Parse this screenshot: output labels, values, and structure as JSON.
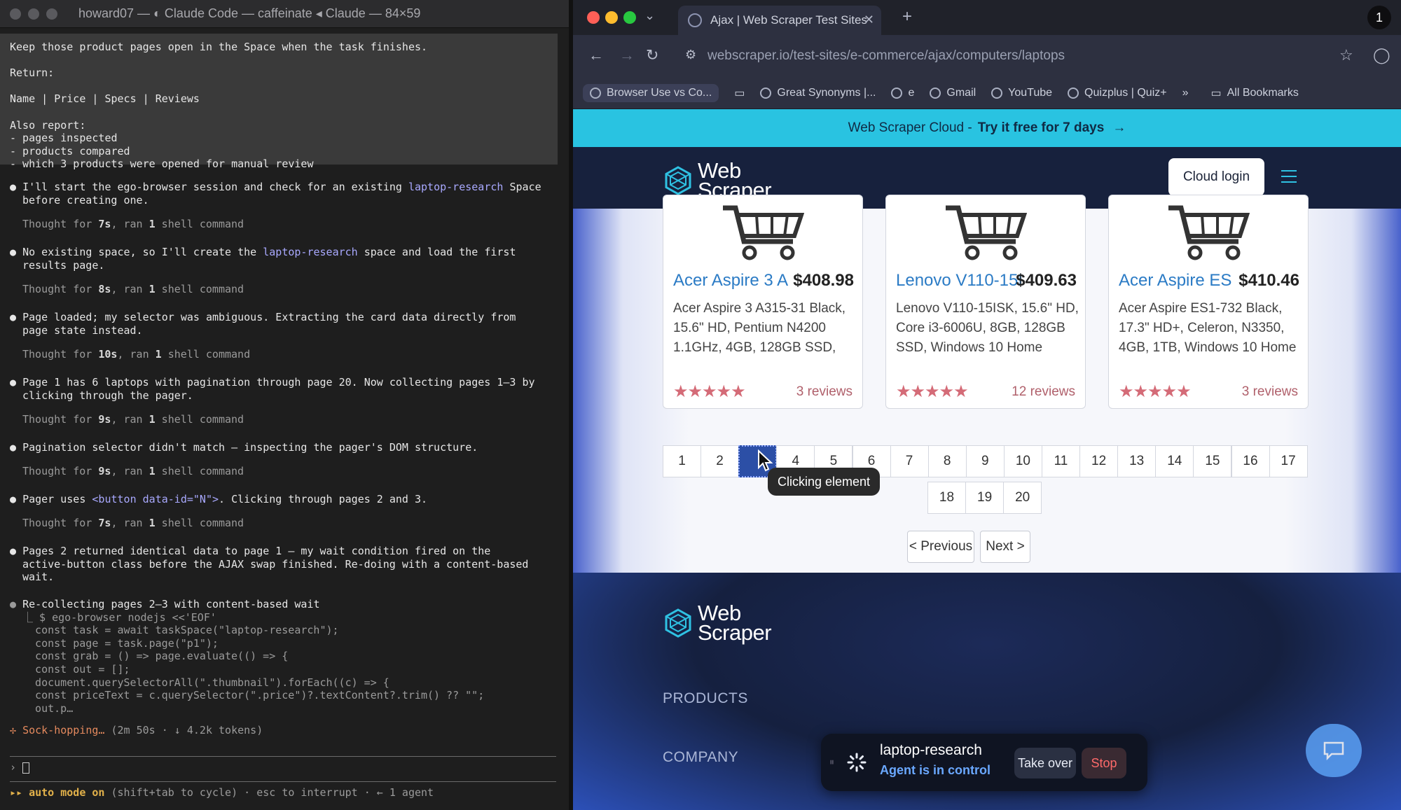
{
  "terminal": {
    "title": "howard07 — ◐ Claude Code — caffeinate ◂ Claude — 84×59",
    "prompt_lines": [
      "Keep those product pages open in the Space when the task finishes.",
      "",
      "Return:",
      "",
      "Name | Price | Specs | Reviews",
      "",
      "Also report:",
      "- pages inspected",
      "- products compared",
      "- which 3 products were opened for manual review"
    ],
    "msg1_a": "I'll start the ego-browser session and check for an existing ",
    "msg1_hl": "laptop-research",
    "msg1_b": " Space",
    "msg1_c": "before creating one.",
    "think1_pre": "Thought for ",
    "think1_t": "7s",
    "think1_mid": ", ran ",
    "think1_n": "1",
    "think1_post": " shell command",
    "msg2_a": "No existing space, so I'll create the ",
    "msg2_hl": "laptop-research",
    "msg2_b": " space and load the first",
    "msg2_c": "results page.",
    "think2_pre": "Thought for ",
    "think2_t": "8s",
    "think2_mid": ", ran ",
    "think2_n": "1",
    "think2_post": " shell command",
    "msg3_a": "Page loaded; my selector was ambiguous. Extracting the card data directly from",
    "msg3_b": "page state instead.",
    "think3_pre": "Thought for ",
    "think3_t": "10s",
    "think3_mid": ", ran ",
    "think3_n": "1",
    "think3_post": " shell command",
    "msg4_a": "Page 1 has 6 laptops with pagination through page 20. Now collecting pages 1–3 by",
    "msg4_b": "clicking through the pager.",
    "think4_pre": "Thought for ",
    "think4_t": "9s",
    "think4_mid": ", ran ",
    "think4_n": "1",
    "think4_post": " shell command",
    "msg5": "Pagination selector didn't match — inspecting the pager's DOM structure.",
    "think5_pre": "Thought for ",
    "think5_t": "9s",
    "think5_mid": ", ran ",
    "think5_n": "1",
    "think5_post": " shell command",
    "msg6_a": "Pager uses ",
    "msg6_hl": "<button data-id=\"N\">",
    "msg6_b": ". Clicking through pages 2 and 3.",
    "think6_pre": "Thought for ",
    "think6_t": "7s",
    "think6_mid": ", ran ",
    "think6_n": "1",
    "think6_post": " shell command",
    "msg7_a": "Pages 2 returned identical data to page 1 — my wait condition fired on the",
    "msg7_b": "active-button class before the AJAX swap finished. Re-doing with a content-based",
    "msg7_c": "wait.",
    "msg8": "Re-collecting pages 2–3 with content-based wait",
    "code": [
      "⎿ $ ego-browser nodejs <<'EOF'",
      "  const task = await taskSpace(\"laptop-research\");",
      "  const page = task.page(\"p1\");",
      "  const grab = () => page.evaluate(() => {",
      "  const out = [];",
      "  document.querySelectorAll(\".thumbnail\").forEach((c) => {",
      "  const priceText = c.querySelector(\".price\")?.textContent?.trim() ?? \"\";",
      "  out.p…"
    ],
    "status_spinner": "✢",
    "status_label": "Sock-hopping…",
    "status_meta": " (2m 50s · ↓ 4.2k tokens)",
    "input_prompt": "›",
    "mode_arrows": "▸▸",
    "mode_label": "auto mode on",
    "mode_hint": " (shift+tab to cycle) · esc to interrupt · ← 1 agent"
  },
  "browser": {
    "tab_title": "Ajax | Web Scraper Test Sites",
    "tab_close": "✕",
    "new_tab": "+",
    "profile_badge": "1",
    "url": "webscraper.io/test-sites/e-commerce/ajax/computers/laptops",
    "bookmarks": [
      "Browser Use vs Co...",
      "Great Synonyms |...",
      "e",
      "Gmail",
      "YouTube",
      "Quizplus | Quiz+"
    ],
    "bookmarks_more": "»",
    "all_bookmarks": "All Bookmarks"
  },
  "site": {
    "promo_text": "Web Scraper Cloud -",
    "promo_link": "Try it free for 7 days",
    "promo_arrow": "→",
    "logo_line1": "Web",
    "logo_line2": "Scraper",
    "cloud_login": "Cloud login",
    "products": [
      {
        "title": "Acer Aspire 3 A",
        "price": "$408.98",
        "desc": "Acer Aspire 3 A315-31 Black, 15.6\" HD, Pentium N4200 1.1GHz, 4GB, 128GB SSD,",
        "stars": "★★★★★",
        "reviews": "3 reviews"
      },
      {
        "title": "Lenovo V110-15I",
        "price": "$409.63",
        "desc": "Lenovo V110-15ISK, 15.6\" HD, Core i3-6006U, 8GB, 128GB SSD, Windows 10 Home",
        "stars": "★★★★★",
        "reviews": "12 reviews"
      },
      {
        "title": "Acer Aspire ES",
        "price": "$410.46",
        "desc": "Acer Aspire ES1-732 Black, 17.3\" HD+, Celeron, N3350, 4GB, 1TB, Windows 10 Home",
        "stars": "★★★★★",
        "reviews": "3 reviews"
      }
    ],
    "pages": [
      "1",
      "2",
      "3",
      "4",
      "5",
      "6",
      "7",
      "8",
      "9",
      "10",
      "11",
      "12",
      "13",
      "14",
      "15",
      "16",
      "17",
      "18",
      "19",
      "20"
    ],
    "active_page": "3",
    "tooltip": "Clicking element",
    "prev": "< Previous",
    "next": "Next >",
    "footer_products": "PRODUCTS",
    "footer_company": "COMPANY"
  },
  "agent": {
    "space": "laptop-research",
    "status": "Agent is in control",
    "take_over": "Take over",
    "stop": "Stop"
  }
}
